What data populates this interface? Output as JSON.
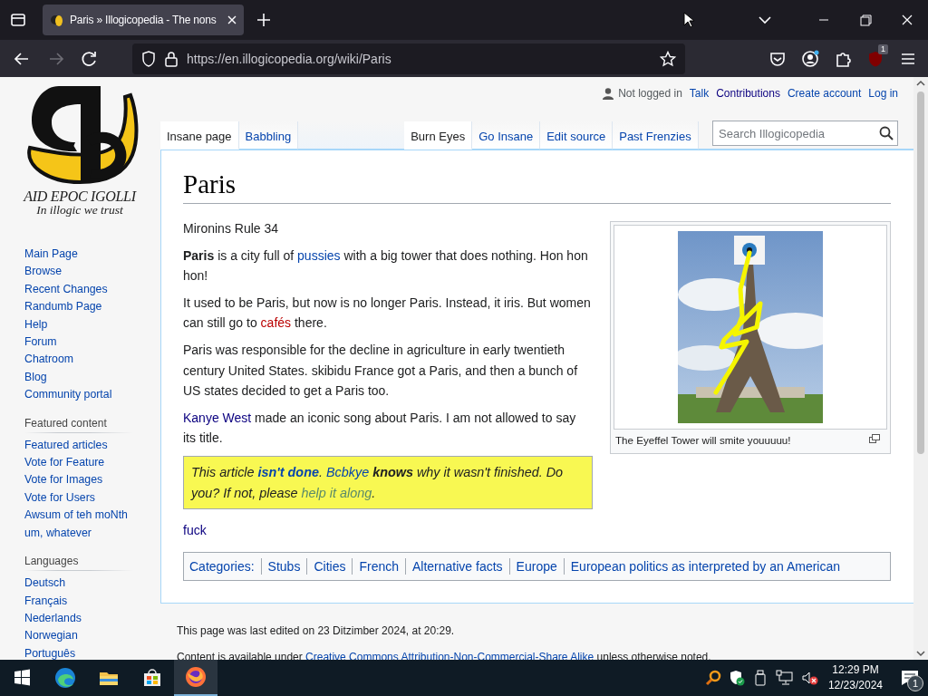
{
  "browser": {
    "tab_title": "Paris » Illogicopedia - The nons",
    "url": "https://en.illogicopedia.org/wiki/Paris",
    "forward_disabled": true,
    "extension_badge": "1"
  },
  "personal_tools": [
    {
      "label": "Not logged in",
      "kind": "status"
    },
    {
      "label": "Talk",
      "kind": "link"
    },
    {
      "label": "Contributions",
      "kind": "visited"
    },
    {
      "label": "Create account",
      "kind": "link"
    },
    {
      "label": "Log in",
      "kind": "link"
    }
  ],
  "logo": {
    "title": "AID EPOC IGOLLI",
    "motto": "In illogic we trust"
  },
  "sidebar": {
    "sections": [
      {
        "items": [
          "Main Page",
          "Browse",
          "Recent Changes",
          "Randumb Page",
          "Help",
          "Forum",
          "Chatroom",
          "Blog",
          "Community portal"
        ]
      },
      {
        "heading": "Featured content",
        "items": [
          "Featured articles",
          "Vote for Feature",
          "Vote for Images",
          "Vote for Users",
          "Awsum of teh moNth",
          "um, whatever"
        ]
      },
      {
        "heading": "Languages",
        "items": [
          "Deutsch",
          "Français",
          "Nederlands",
          "Norwegian",
          "Português"
        ]
      }
    ]
  },
  "page_tabs": [
    {
      "label": "Insane page",
      "selected": true
    },
    {
      "label": "Babbling",
      "selected": false
    }
  ],
  "view_tabs": [
    {
      "label": "Burn Eyes",
      "selected": true
    },
    {
      "label": "Go Insane",
      "selected": false
    },
    {
      "label": "Edit source",
      "selected": false
    },
    {
      "label": "Past Frenzies",
      "selected": false
    }
  ],
  "search": {
    "placeholder": "Search Illogicopedia"
  },
  "article": {
    "title": "Paris",
    "subtitle": "Mironins Rule 34",
    "paragraphs": [
      [
        {
          "kind": "bold",
          "text": "Paris"
        },
        {
          "kind": "text",
          "text": " is a city full of "
        },
        {
          "kind": "link",
          "text": "pussies"
        },
        {
          "kind": "text",
          "text": " with a big tower that does nothing. Hon hon hon!"
        }
      ],
      [
        {
          "kind": "text",
          "text": "It used to be Paris, but now is no longer Paris. Instead, it iris. But women can still go to "
        },
        {
          "kind": "redlink",
          "text": "cafés"
        },
        {
          "kind": "text",
          "text": " there."
        }
      ],
      [
        {
          "kind": "text",
          "text": "Paris was responsible for the decline in agriculture in early twentieth century United States. skibidu France got a Paris, and then a bunch of US states decided to get a Paris too."
        }
      ],
      [
        {
          "kind": "visited",
          "text": "Kanye West"
        },
        {
          "kind": "text",
          "text": " made an iconic song about Paris. I am not allowed to say its title."
        }
      ]
    ],
    "notice": [
      {
        "kind": "text",
        "text": "This article "
      },
      {
        "kind": "boldlink",
        "text": "isn't done"
      },
      {
        "kind": "text",
        "text": ". "
      },
      {
        "kind": "link",
        "text": "Bcbkye"
      },
      {
        "kind": "bold",
        "text": " knows"
      },
      {
        "kind": "text",
        "text": " why it wasn't finished. Do you? If not, please "
      },
      {
        "kind": "greenlink",
        "text": "help it along"
      },
      {
        "kind": "text",
        "text": "."
      }
    ],
    "after_notice": [
      {
        "kind": "visited",
        "text": "fuck"
      }
    ],
    "thumbnail": {
      "caption": "The Eyeffel Tower will smite youuuuu!"
    },
    "categories": {
      "label": "Categories:",
      "items": [
        "Stubs",
        "Cities",
        "French",
        "Alternative facts",
        "Europe",
        "European politics as interpreted by an American"
      ]
    }
  },
  "footer": [
    [
      {
        "kind": "text",
        "text": "This page was last edited on 23 Ditzimber 2024, at 20:29."
      }
    ],
    [
      {
        "kind": "text",
        "text": "Content is available under "
      },
      {
        "kind": "link",
        "text": "Creative Commons Attribution-Non-Commercial-Share Alike"
      },
      {
        "kind": "text",
        "text": " unless otherwise noted."
      }
    ]
  ],
  "taskbar": {
    "apps": [
      {
        "kind": "edge",
        "selected": false
      },
      {
        "kind": "files",
        "selected": false
      },
      {
        "kind": "store",
        "selected": false
      },
      {
        "kind": "firefox",
        "selected": true
      }
    ],
    "time": "12:29 PM",
    "date": "12/23/2024",
    "notifications": "1"
  }
}
